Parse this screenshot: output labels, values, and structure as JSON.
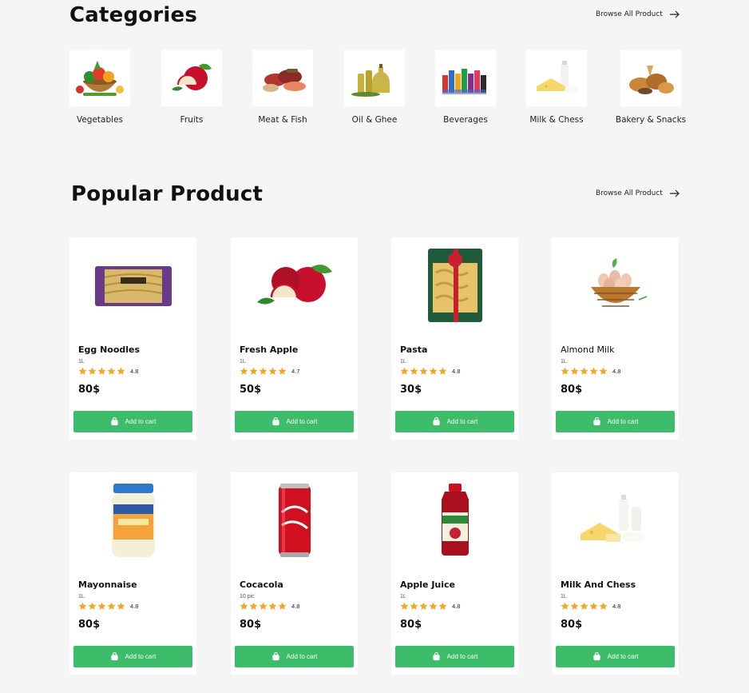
{
  "categories_section": {
    "title": "Categories",
    "browse_label": "Browse All Product",
    "items": [
      {
        "label": "Vegetables",
        "icon": "vegetable-basket-icon"
      },
      {
        "label": "Fruits",
        "icon": "apple-icon"
      },
      {
        "label": "Meat & Fish",
        "icon": "meat-fish-icon"
      },
      {
        "label": "Oil & Ghee",
        "icon": "oil-bottle-icon"
      },
      {
        "label": "Beverages",
        "icon": "beverage-bottles-icon"
      },
      {
        "label": "Milk & Chess",
        "icon": "milk-cheese-icon"
      },
      {
        "label": "Bakery & Snacks",
        "icon": "bread-icon"
      }
    ]
  },
  "popular_section": {
    "title": "Popular Product",
    "browse_label": "Browse All Product",
    "add_to_cart_label": "Add to cart",
    "products": [
      {
        "name": "Egg Noodles",
        "unit": "1L",
        "rating": "4.8",
        "price": "80$",
        "image": "noodles-pack-icon"
      },
      {
        "name": "Fresh Apple",
        "unit": "1L",
        "rating": "4.7",
        "price": "50$",
        "image": "apple-icon"
      },
      {
        "name": "Pasta",
        "unit": "1L",
        "rating": "4.8",
        "price": "30$",
        "image": "pasta-bag-icon"
      },
      {
        "name": "Almond Milk",
        "unit": "1L",
        "rating": "4.8",
        "price": "80$",
        "image": "egg-basket-icon"
      },
      {
        "name": "Mayonnaise",
        "unit": "1L",
        "rating": "4.8",
        "price": "80$",
        "image": "mayonnaise-jar-icon"
      },
      {
        "name": "Cocacola",
        "unit": "10 pic",
        "rating": "4.8",
        "price": "80$",
        "image": "cola-can-icon"
      },
      {
        "name": "Apple Juice",
        "unit": "1L",
        "rating": "4.8",
        "price": "80$",
        "image": "juice-bottle-icon"
      },
      {
        "name": "Milk And Chess",
        "unit": "1L",
        "rating": "4.8",
        "price": "80$",
        "image": "milk-cheese-icon"
      }
    ]
  },
  "colors": {
    "background": "#f5f5f5",
    "accent_green": "#3dbd6a",
    "star": "#f5a623"
  }
}
